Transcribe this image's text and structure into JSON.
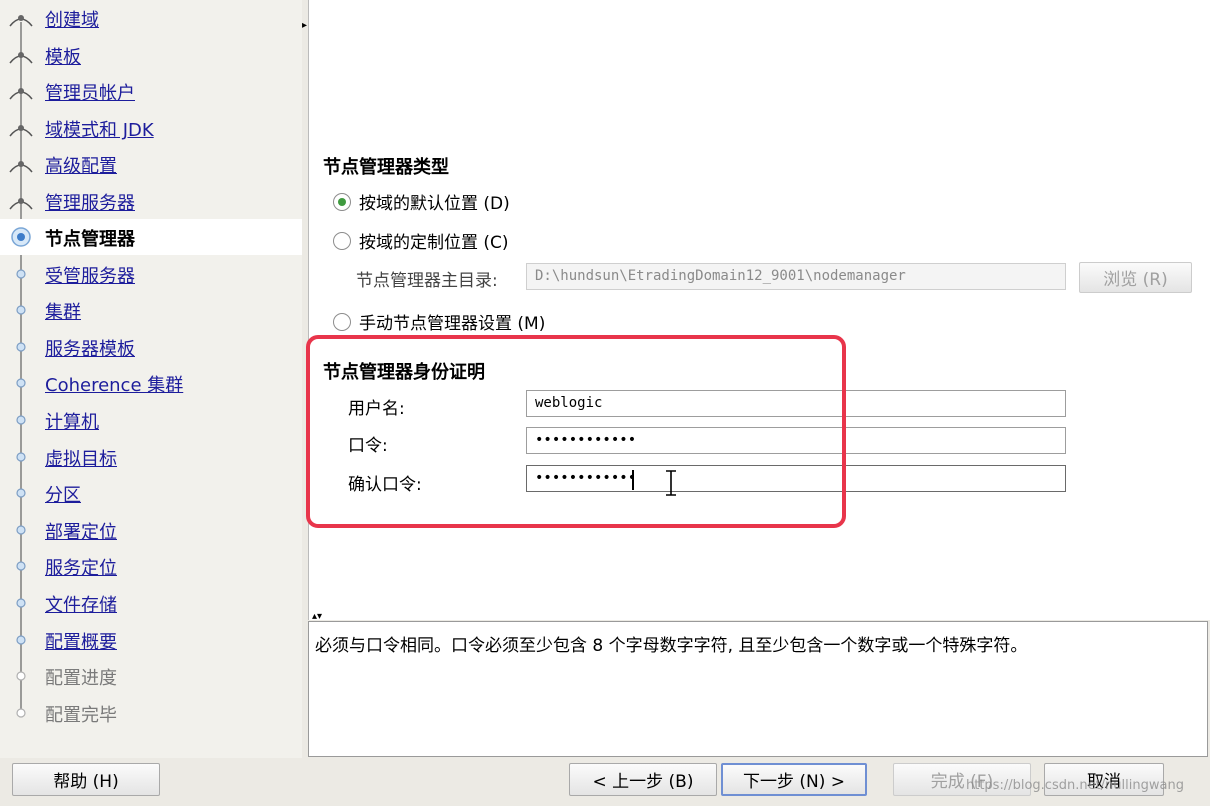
{
  "nav": {
    "items": [
      {
        "label": "创建域",
        "state": "done"
      },
      {
        "label": "模板",
        "state": "done"
      },
      {
        "label": "管理员帐户",
        "state": "done"
      },
      {
        "label": "域模式和 JDK",
        "state": "done"
      },
      {
        "label": "高级配置",
        "state": "done"
      },
      {
        "label": "管理服务器",
        "state": "done"
      },
      {
        "label": "节点管理器",
        "state": "active"
      },
      {
        "label": "受管服务器",
        "state": "todo"
      },
      {
        "label": "集群",
        "state": "todo"
      },
      {
        "label": "服务器模板",
        "state": "todo"
      },
      {
        "label": "Coherence 集群",
        "state": "todo"
      },
      {
        "label": "计算机",
        "state": "todo"
      },
      {
        "label": "虚拟目标",
        "state": "todo"
      },
      {
        "label": "分区",
        "state": "todo"
      },
      {
        "label": "部署定位",
        "state": "todo"
      },
      {
        "label": "服务定位",
        "state": "todo"
      },
      {
        "label": "文件存储",
        "state": "todo"
      },
      {
        "label": "配置概要",
        "state": "todo"
      },
      {
        "label": "配置进度",
        "state": "disabled"
      },
      {
        "label": "配置完毕",
        "state": "disabled"
      }
    ]
  },
  "node_manager_type": {
    "title": "节点管理器类型",
    "options": [
      {
        "label": "按域的默认位置 (D)",
        "selected": true
      },
      {
        "label": "按域的定制位置 (C)",
        "selected": false
      },
      {
        "label": "手动节点管理器设置 (M)",
        "selected": false
      }
    ],
    "home_dir_label": "节点管理器主目录:",
    "home_dir_value": "D:\\hundsun\\EtradingDomain12_9001\\nodemanager",
    "browse_label": "浏览 (R)"
  },
  "credentials": {
    "title": "节点管理器身份证明",
    "username_label": "用户名:",
    "username_value": "weblogic",
    "password_label": "口令:",
    "password_value": "••••••••••••",
    "confirm_label": "确认口令:",
    "confirm_value": "••••••••••••"
  },
  "help": {
    "text": "必须与口令相同。口令必须至少包含 8 个字母数字字符, 且至少包含一个数字或一个特殊字符。"
  },
  "buttons": {
    "help": "帮助 (H)",
    "back": "< 上一步 (B)",
    "next": "下一步 (N) >",
    "finish": "完成 (F)",
    "cancel": "取消"
  },
  "watermark": "https://blog.csdn.net/nullingwang",
  "colors": {
    "highlight": "#e8354b",
    "link": "#1d1d9c",
    "radio_selected": "#3f9a3f"
  },
  "icons": {
    "nav_done": "branch-node-icon",
    "nav_active": "current-step-icon",
    "nav_todo": "pending-step-icon"
  }
}
